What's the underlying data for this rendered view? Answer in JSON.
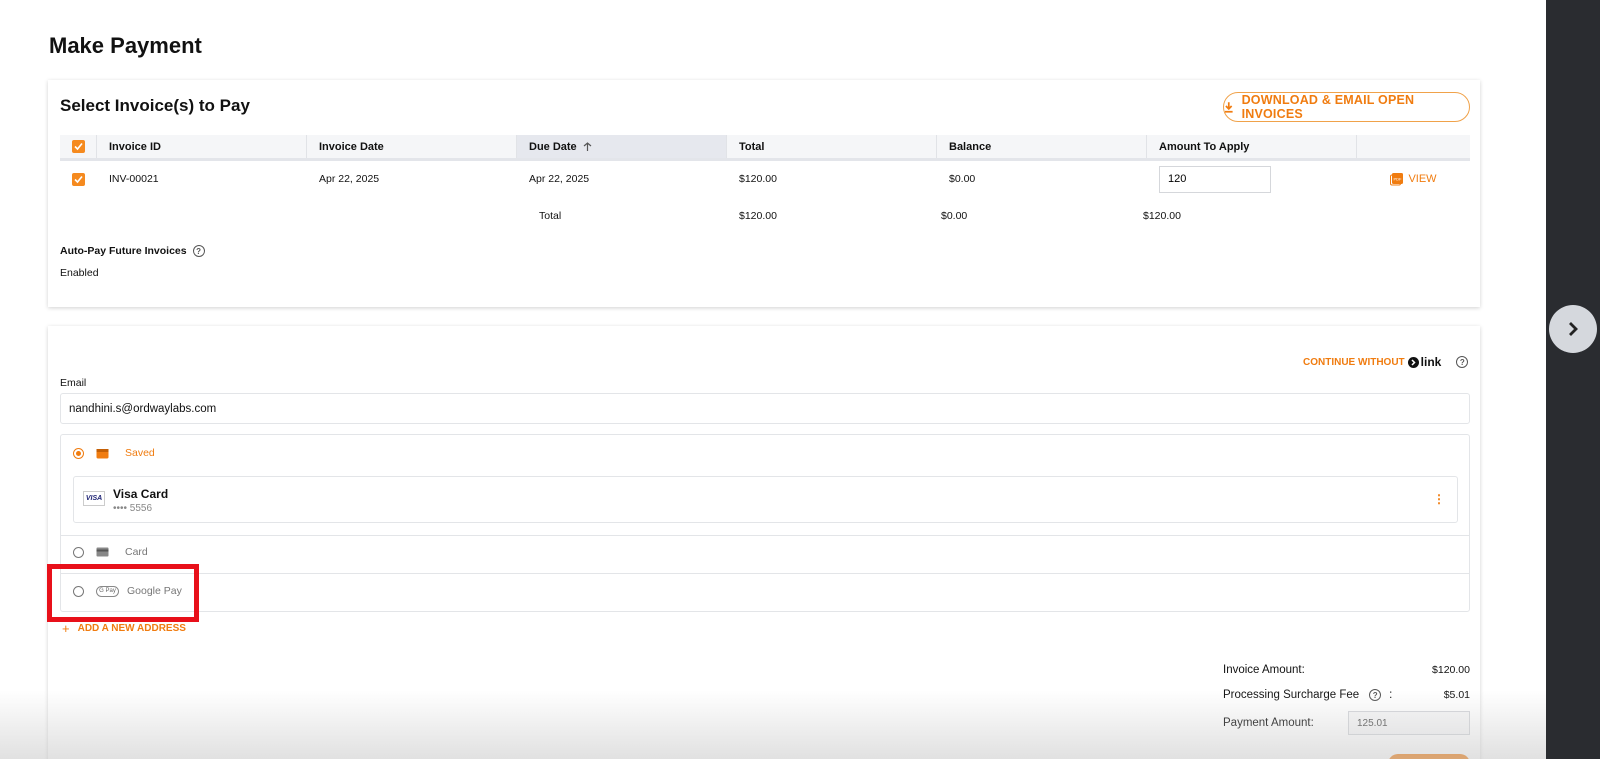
{
  "page": {
    "title": "Make Payment"
  },
  "invoices": {
    "section_title": "Select Invoice(s) to Pay",
    "download_label": "DOWNLOAD & EMAIL OPEN INVOICES",
    "columns": [
      "Invoice ID",
      "Invoice Date",
      "Due Date",
      "Total",
      "Balance",
      "Amount To Apply"
    ],
    "sorted_column": "Due Date",
    "row": {
      "id": "INV-00021",
      "invoice_date": "Apr 22, 2025",
      "due_date": "Apr 22, 2025",
      "total": "$120.00",
      "balance": "$0.00",
      "amount_to_apply": "120",
      "view_label": "VIEW"
    },
    "totals": {
      "label": "Total",
      "total": "$120.00",
      "balance": "$0.00",
      "amount": "$120.00"
    },
    "autopay": {
      "label": "Auto-Pay Future Invoices",
      "value": "Enabled"
    }
  },
  "payment": {
    "continue_label": "CONTINUE WITHOUT",
    "link_label": "link",
    "email_label": "Email",
    "email_value": "nandhini.s@ordwaylabs.com",
    "options": {
      "saved": "Saved",
      "card": "Card",
      "google_pay": "Google Pay",
      "gpay_badge": "G Pay"
    },
    "saved_card": {
      "logo": "VISA",
      "name": "Visa Card",
      "number": "•••• 5556"
    },
    "add_address": "ADD A NEW ADDRESS",
    "summary": {
      "invoice_amount_label": "Invoice Amount:",
      "invoice_amount": "$120.00",
      "surcharge_label": "Processing Surcharge Fee",
      "surcharge": "$5.01",
      "payment_amount_label": "Payment Amount:",
      "payment_amount": "125.01"
    }
  },
  "colors": {
    "accent": "#f07c10",
    "highlight": "#e8101a",
    "rail": "#2a2c30"
  }
}
